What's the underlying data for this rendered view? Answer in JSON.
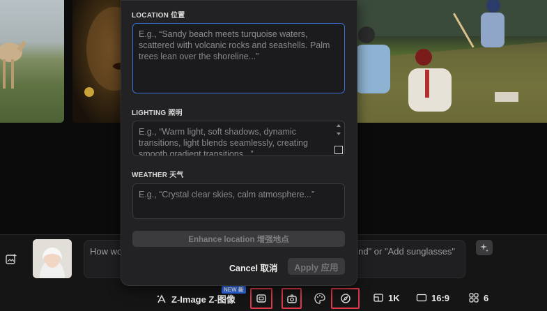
{
  "panel": {
    "location": {
      "label": "LOCATION  位置",
      "placeholder": "E.g., “Sandy beach meets turquoise waters, scattered with volcanic rocks and seashells. Palm trees lean over the shoreline...”"
    },
    "lighting": {
      "label": "LIGHTING  照明",
      "placeholder": "E.g., “Warm light, soft shadows, dynamic transitions, light blends seamlessly, creating smooth gradient transitions...”"
    },
    "weather": {
      "label": "WEATHER  天气",
      "placeholder": "E.g., “Crystal clear skies, calm atmosphere...”"
    },
    "enhance_label": "Enhance location  增强地点",
    "cancel_label": "Cancel  取消",
    "apply_label": "Apply  应用"
  },
  "prompt": {
    "text_left": "How wo",
    "text_right": "und\" or \"Add sunglasses\""
  },
  "toolbar": {
    "model_label": "Z-Image  Z-图像",
    "new_badge": "NEW 新",
    "resolution": "1K",
    "ratio": "16:9",
    "count": "6"
  },
  "colors": {
    "accent": "#3b6fd8",
    "highlight": "#e0394a",
    "panel_bg": "#222224",
    "badge": "#2f6df6"
  },
  "icons": [
    "image-add-icon",
    "sparkle-icon",
    "model-icon",
    "frame-icon",
    "camera-icon",
    "palette-icon",
    "compass-icon",
    "aspect-icon",
    "ratio-icon",
    "grid-icon"
  ]
}
